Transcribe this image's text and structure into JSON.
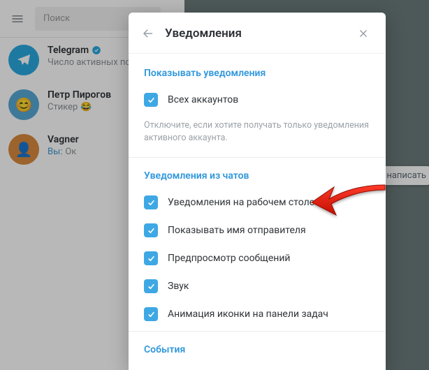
{
  "search": {
    "placeholder": "Поиск"
  },
  "write_pill": "написать",
  "chats": [
    {
      "title": "Telegram",
      "subtitle": "Число активных поль",
      "verified": true
    },
    {
      "title": "Петр Пирогов",
      "subtitle_prefix": "Стикер",
      "emoji": "😂"
    },
    {
      "title": "Vagner",
      "you_prefix": "Вы:",
      "subtitle": "Ок"
    }
  ],
  "modal": {
    "title": "Уведомления",
    "section1": {
      "title": "Показывать уведомления",
      "option": "Всех аккаунтов",
      "note": "Отключите, если хотите получать только уведомления активного аккаунта."
    },
    "section2": {
      "title": "Уведомления из чатов",
      "opts": [
        "Уведомления на рабочем столе",
        "Показывать имя отправителя",
        "Предпросмотр сообщений",
        "Звук",
        "Анимация иконки на панели задач"
      ]
    },
    "section3": {
      "title": "События"
    }
  }
}
